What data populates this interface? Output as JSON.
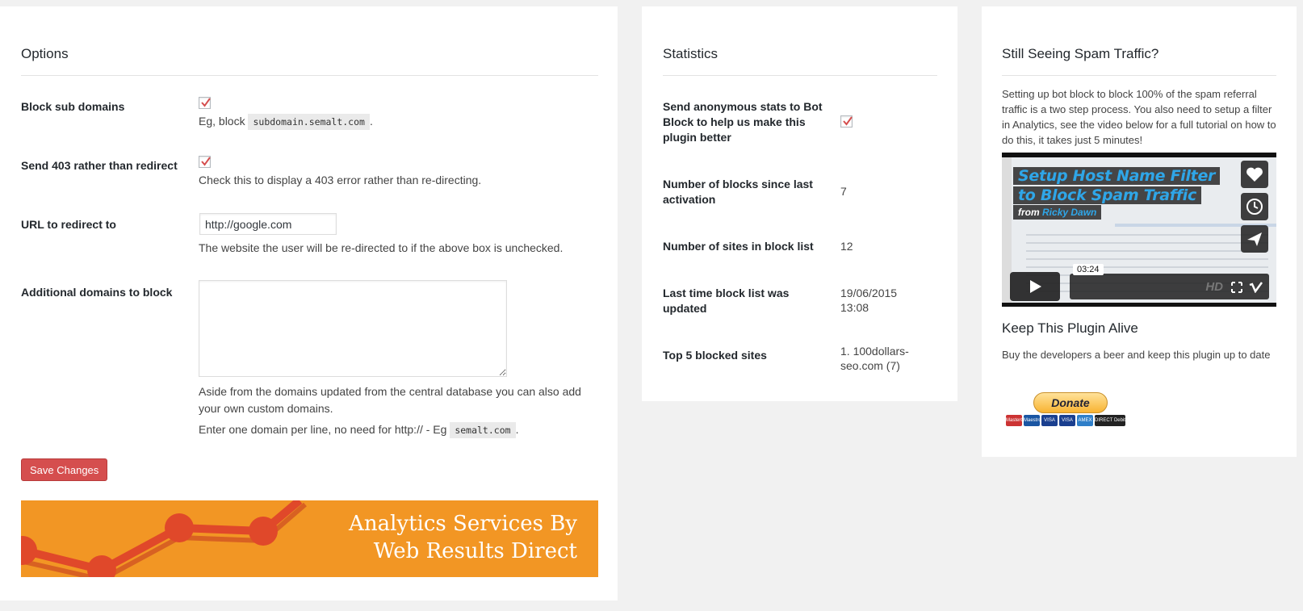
{
  "options": {
    "title": "Options",
    "block_subdomains": {
      "label": "Block sub domains",
      "checked": true,
      "desc_prefix": "Eg, block",
      "desc_code": "subdomain.semalt.com",
      "desc_suffix": "."
    },
    "send_403": {
      "label": "Send 403 rather than redirect",
      "checked": true,
      "desc": "Check this to display a 403 error rather than re-directing."
    },
    "redirect_url": {
      "label": "URL to redirect to",
      "value": "http://google.com",
      "desc": "The website the user will be re-directed to if the above box is unchecked."
    },
    "additional_domains": {
      "label": "Additional domains to block",
      "value": "",
      "desc1": "Aside from the domains updated from the central database you can also add your own custom domains.",
      "desc2_prefix": "Enter one domain per line, no need for http:// - Eg",
      "desc2_code": "semalt.com",
      "desc2_suffix": "."
    },
    "save_label": "Save Changes",
    "banner_line1": "Analytics Services By",
    "banner_line2": "Web Results Direct"
  },
  "statistics": {
    "title": "Statistics",
    "anonymous_stats": {
      "label": "Send anonymous stats to Bot Block to help us make this plugin better",
      "checked": true
    },
    "blocks_since_activation": {
      "label": "Number of blocks since last activation",
      "value": "7"
    },
    "sites_in_list": {
      "label": "Number of sites in block list",
      "value": "12"
    },
    "last_updated": {
      "label": "Last time block list was updated",
      "value": "19/06/2015 13:08"
    },
    "top_blocked": {
      "label": "Top 5 blocked sites",
      "value": "1. 100dollars-seo.com (7)"
    }
  },
  "spam": {
    "title": "Still Seeing Spam Traffic?",
    "text": "Setting up bot block to block 100% of the spam referral traffic is a two step process. You also need to setup a filter in Analytics, see the video below for a full tutorial on how to do this, it takes just 5 minutes!",
    "video": {
      "title_line1": "Setup Host Name Filter",
      "title_line2": "to Block Spam Traffic",
      "byline_prefix": "from",
      "byline_author": "Ricky Dawn",
      "duration": "03:24",
      "hd_label": "HD"
    },
    "keep_alive_title": "Keep This Plugin Alive",
    "keep_alive_text": "Buy the developers a beer and keep this plugin up to date",
    "donate_label": "Donate",
    "cards": [
      "MasterCard",
      "Maestro",
      "VISA",
      "VISA",
      "AMEX",
      "DIRECT Debit"
    ]
  },
  "colors": {
    "accent_red": "#d54e4e",
    "banner_orange": "#f29624",
    "check_red": "#d54e4e"
  }
}
